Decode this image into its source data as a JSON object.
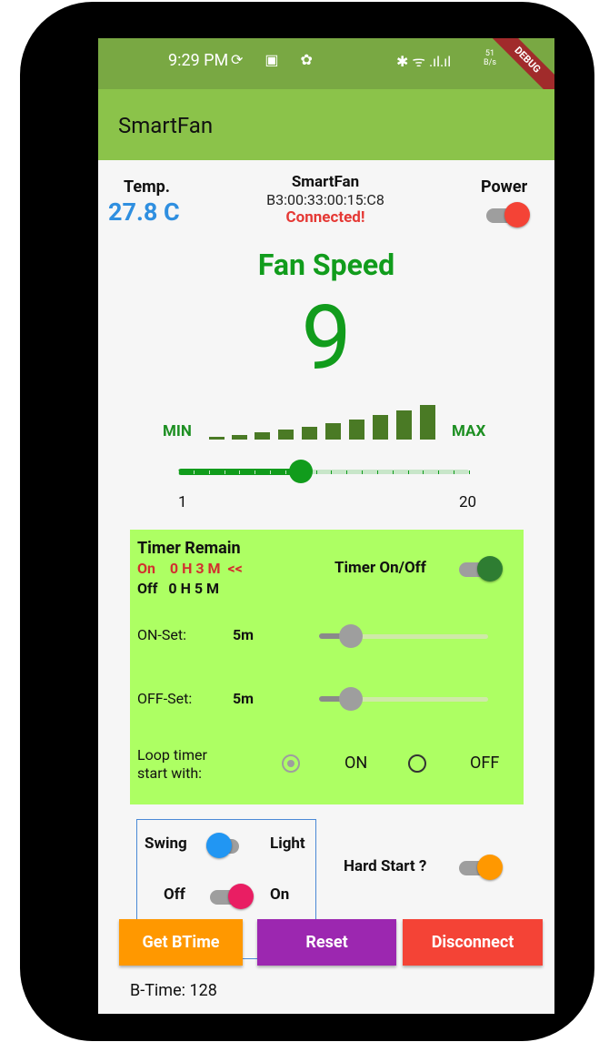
{
  "status_bar": {
    "time": "9:29 PM",
    "icons_left": "⟳ ▣ ✿",
    "icons_right": "✱ ᯤ .ıl.ıl",
    "netspeed_top": "51",
    "netspeed_bottom": "B/s",
    "debug": "DEBUG"
  },
  "appbar": {
    "title": "SmartFan"
  },
  "header": {
    "temp_label": "Temp.",
    "temp_value": "27.8 C",
    "device_name": "SmartFan",
    "device_mac": "B3:00:33:00:15:C8",
    "connection_status": "Connected!",
    "power_label": "Power"
  },
  "fan": {
    "title": "Fan Speed",
    "speed": "9",
    "min_label": "MIN",
    "max_label": "MAX",
    "slider_min": "1",
    "slider_max": "20",
    "level": 9,
    "range": [
      1,
      20
    ]
  },
  "timer": {
    "remain_label": "Timer Remain",
    "on_line": "On    0 H 3 M  <<",
    "off_line": "Off   0 H 5 M",
    "toggle_label": "Timer On/Off",
    "onset_label": "ON-Set:",
    "onset_value": "5m",
    "offset_label": "OFF-Set:",
    "offset_value": "5m",
    "loop_label_1": "Loop timer",
    "loop_label_2": "start with:",
    "loop_on": "ON",
    "loop_off": "OFF"
  },
  "swing": {
    "swing": "Swing",
    "light": "Light",
    "off": "Off",
    "on": "On"
  },
  "hard_start": {
    "label": "Hard Start ?"
  },
  "buttons": {
    "get_btime": "Get BTime",
    "reset": "Reset",
    "disconnect": "Disconnect"
  },
  "footer": {
    "btime": "B-Time: 128"
  },
  "colors": {
    "appbar": "#8bc34a",
    "statusbar": "#79a843",
    "temp": "#2f8fe0",
    "connected": "#e53935",
    "fan_green": "#119c1c",
    "timer_bg": "#adff63",
    "btn_orange": "#ff9800",
    "btn_purple": "#9c27b0",
    "btn_red": "#f44336"
  }
}
